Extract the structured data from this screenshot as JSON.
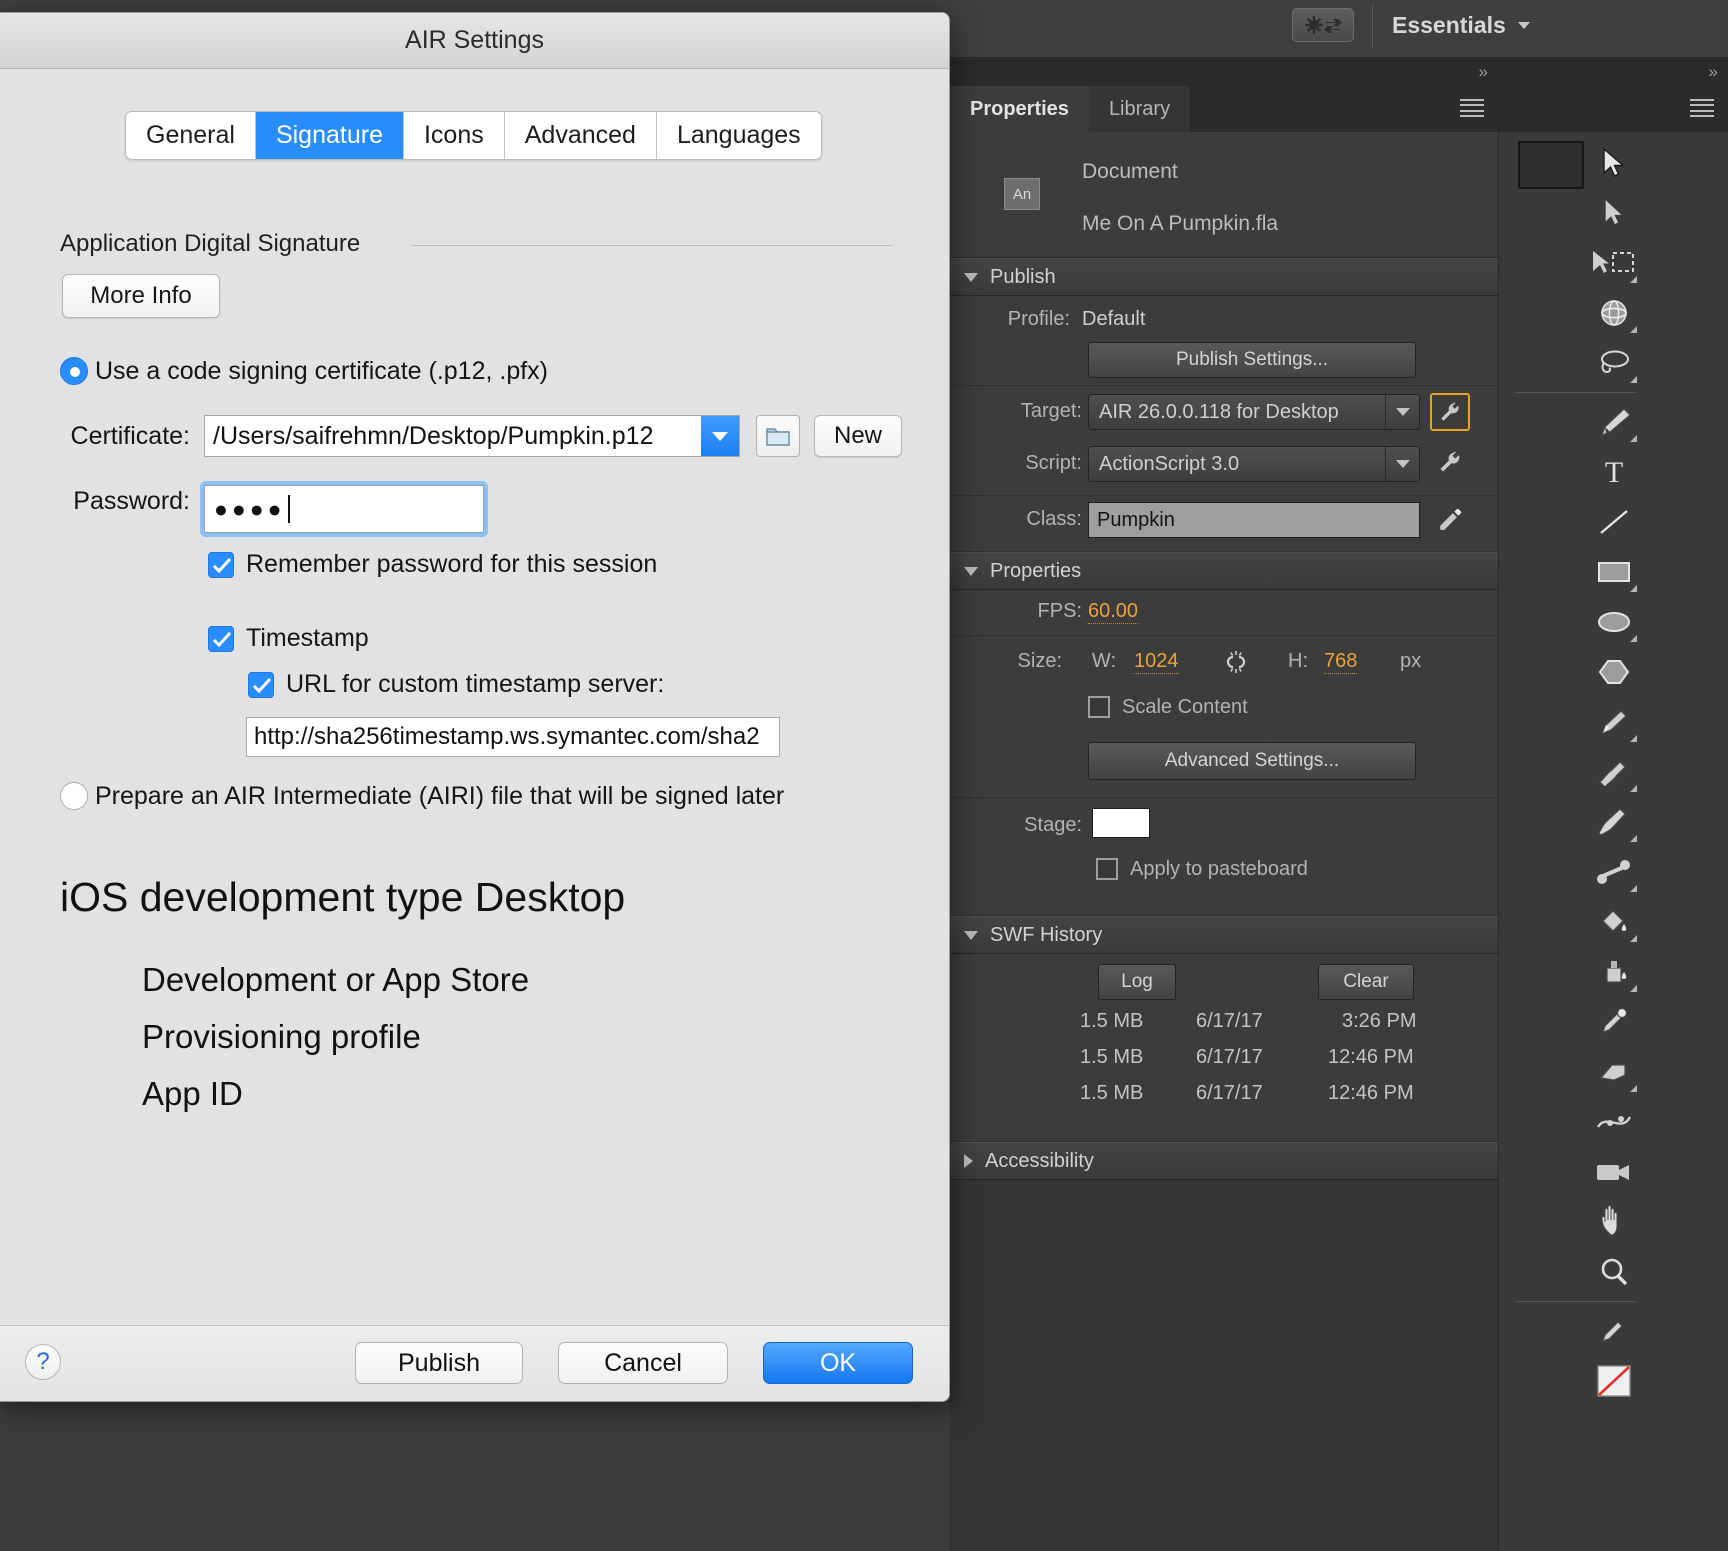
{
  "app": {
    "workspace_label": "Essentials",
    "workspace_switch_icon": "switch-workspace-icon",
    "expand_chevron": "»"
  },
  "properties_panel": {
    "tabs": [
      {
        "label": "Properties",
        "active": true
      },
      {
        "label": "Library",
        "active": false
      }
    ],
    "document": {
      "icon_text": "An",
      "type_label": "Document",
      "file_name": "Me On A Pumpkin.fla"
    },
    "publish": {
      "section_title": "Publish",
      "profile_label": "Profile:",
      "profile_value": "Default",
      "publish_settings_button": "Publish Settings...",
      "target_label": "Target:",
      "target_value": "AIR 26.0.0.118 for Desktop",
      "script_label": "Script:",
      "script_value": "ActionScript 3.0",
      "class_label": "Class:",
      "class_value": "Pumpkin"
    },
    "properties": {
      "section_title": "Properties",
      "fps_label": "FPS:",
      "fps_value": "60.00",
      "size_label": "Size:",
      "w_label": "W:",
      "w_value": "1024",
      "h_label": "H:",
      "h_value": "768",
      "units": "px",
      "scale_content_label": "Scale Content",
      "scale_content_checked": false,
      "advanced_settings_button": "Advanced Settings...",
      "stage_label": "Stage:",
      "stage_color": "#ffffff",
      "apply_to_pasteboard_label": "Apply to pasteboard",
      "apply_to_pasteboard_checked": false
    },
    "swf_history": {
      "section_title": "SWF History",
      "log_button": "Log",
      "clear_button": "Clear",
      "entries": [
        {
          "size": "1.5 MB",
          "date": "6/17/17",
          "time": "3:26 PM"
        },
        {
          "size": "1.5 MB",
          "date": "6/17/17",
          "time": "12:46 PM"
        },
        {
          "size": "1.5 MB",
          "date": "6/17/17",
          "time": "12:46 PM"
        }
      ]
    },
    "accessibility": {
      "section_title": "Accessibility",
      "expanded": false
    }
  },
  "toolbar": {
    "tools": [
      "selection-tool",
      "subselection-tool",
      "free-transform-tool",
      "3d-rotation-tool",
      "lasso-tool",
      "pen-tool",
      "text-tool",
      "line-tool",
      "rectangle-tool",
      "oval-tool",
      "polystar-tool",
      "pencil-tool",
      "brush-tool",
      "paint-brush-tool",
      "bone-tool",
      "paint-bucket-tool",
      "ink-bottle-tool",
      "eyedropper-tool",
      "eraser-tool",
      "width-tool",
      "camera-tool",
      "hand-tool",
      "zoom-tool",
      "stroke-color-tool",
      "fill-color-tool"
    ]
  },
  "dialog": {
    "title": "AIR Settings",
    "tabs": [
      {
        "label": "General",
        "active": false
      },
      {
        "label": "Signature",
        "active": true
      },
      {
        "label": "Icons",
        "active": false
      },
      {
        "label": "Advanced",
        "active": false
      },
      {
        "label": "Languages",
        "active": false
      }
    ],
    "section_title": "Application Digital Signature",
    "more_info_button": "More Info",
    "use_cert_radio": {
      "label": "Use a code signing certificate (.p12, .pfx)",
      "selected": true
    },
    "certificate": {
      "label": "Certificate:",
      "value": "/Users/saifrehmn/Desktop/Pumpkin.p12",
      "browse_icon": "folder-icon",
      "new_button": "New"
    },
    "password": {
      "label": "Password:",
      "value": "●●●●",
      "focused": true
    },
    "remember_password": {
      "label": "Remember password for this session",
      "checked": true
    },
    "timestamp": {
      "label": "Timestamp",
      "checked": true
    },
    "custom_timestamp_url": {
      "label": "URL for custom timestamp server:",
      "checked": true,
      "value": "http://sha256timestamp.ws.symantec.com/sha2"
    },
    "airi_radio": {
      "label": "Prepare an AIR Intermediate (AIRI) file that will be signed later",
      "selected": false
    },
    "ios_heading": "iOS development type Desktop",
    "ios_items": [
      "Development or App Store",
      "Provisioning profile",
      "App ID"
    ],
    "help_button": "?",
    "footer": {
      "publish": "Publish",
      "cancel": "Cancel",
      "ok": "OK"
    }
  }
}
